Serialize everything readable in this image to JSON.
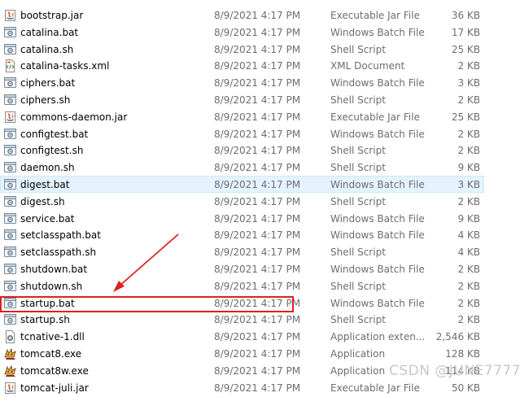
{
  "files": [
    {
      "name": "bootstrap.jar",
      "date": "8/9/2021 4:17 PM",
      "type": "Executable Jar File",
      "size": "36 KB",
      "icon": "jar-file-icon"
    },
    {
      "name": "catalina.bat",
      "date": "8/9/2021 4:17 PM",
      "type": "Windows Batch File",
      "size": "17 KB",
      "icon": "batch-file-icon"
    },
    {
      "name": "catalina.sh",
      "date": "8/9/2021 4:17 PM",
      "type": "Shell Script",
      "size": "25 KB",
      "icon": "shell-script-icon"
    },
    {
      "name": "catalina-tasks.xml",
      "date": "8/9/2021 4:17 PM",
      "type": "XML Document",
      "size": "2 KB",
      "icon": "xml-file-icon"
    },
    {
      "name": "ciphers.bat",
      "date": "8/9/2021 4:17 PM",
      "type": "Windows Batch File",
      "size": "3 KB",
      "icon": "batch-file-icon"
    },
    {
      "name": "ciphers.sh",
      "date": "8/9/2021 4:17 PM",
      "type": "Shell Script",
      "size": "2 KB",
      "icon": "shell-script-icon"
    },
    {
      "name": "commons-daemon.jar",
      "date": "8/9/2021 4:17 PM",
      "type": "Executable Jar File",
      "size": "25 KB",
      "icon": "jar-file-icon"
    },
    {
      "name": "configtest.bat",
      "date": "8/9/2021 4:17 PM",
      "type": "Windows Batch File",
      "size": "2 KB",
      "icon": "batch-file-icon"
    },
    {
      "name": "configtest.sh",
      "date": "8/9/2021 4:17 PM",
      "type": "Shell Script",
      "size": "2 KB",
      "icon": "shell-script-icon"
    },
    {
      "name": "daemon.sh",
      "date": "8/9/2021 4:17 PM",
      "type": "Shell Script",
      "size": "9 KB",
      "icon": "shell-script-icon"
    },
    {
      "name": "digest.bat",
      "date": "8/9/2021 4:17 PM",
      "type": "Windows Batch File",
      "size": "3 KB",
      "icon": "batch-file-icon",
      "selected": true
    },
    {
      "name": "digest.sh",
      "date": "8/9/2021 4:17 PM",
      "type": "Shell Script",
      "size": "2 KB",
      "icon": "shell-script-icon"
    },
    {
      "name": "service.bat",
      "date": "8/9/2021 4:17 PM",
      "type": "Windows Batch File",
      "size": "9 KB",
      "icon": "batch-file-icon"
    },
    {
      "name": "setclasspath.bat",
      "date": "8/9/2021 4:17 PM",
      "type": "Windows Batch File",
      "size": "4 KB",
      "icon": "batch-file-icon"
    },
    {
      "name": "setclasspath.sh",
      "date": "8/9/2021 4:17 PM",
      "type": "Shell Script",
      "size": "4 KB",
      "icon": "shell-script-icon"
    },
    {
      "name": "shutdown.bat",
      "date": "8/9/2021 4:17 PM",
      "type": "Windows Batch File",
      "size": "2 KB",
      "icon": "batch-file-icon"
    },
    {
      "name": "shutdown.sh",
      "date": "8/9/2021 4:17 PM",
      "type": "Shell Script",
      "size": "2 KB",
      "icon": "shell-script-icon"
    },
    {
      "name": "startup.bat",
      "date": "8/9/2021 4:17 PM",
      "type": "Windows Batch File",
      "size": "2 KB",
      "icon": "batch-file-icon",
      "highlighted": true
    },
    {
      "name": "startup.sh",
      "date": "8/9/2021 4:17 PM",
      "type": "Shell Script",
      "size": "2 KB",
      "icon": "shell-script-icon"
    },
    {
      "name": "tcnative-1.dll",
      "date": "8/9/2021 4:17 PM",
      "type": "Application exten...",
      "size": "2,546 KB",
      "icon": "dll-file-icon"
    },
    {
      "name": "tomcat8.exe",
      "date": "8/9/2021 4:17 PM",
      "type": "Application",
      "size": "128 KB",
      "icon": "tomcat-exe-icon"
    },
    {
      "name": "tomcat8w.exe",
      "date": "8/9/2021 4:17 PM",
      "type": "Application",
      "size": "114 KB",
      "icon": "tomcat-exe-icon"
    },
    {
      "name": "tomcat-juli.jar",
      "date": "8/9/2021 4:17 PM",
      "type": "Executable Jar File",
      "size": "50 KB",
      "icon": "jar-file-icon"
    }
  ],
  "annotation": {
    "highlight_color": "#e02020",
    "selection_color": "#e5f3ff"
  },
  "watermark": "CSDN @JUNE7777"
}
